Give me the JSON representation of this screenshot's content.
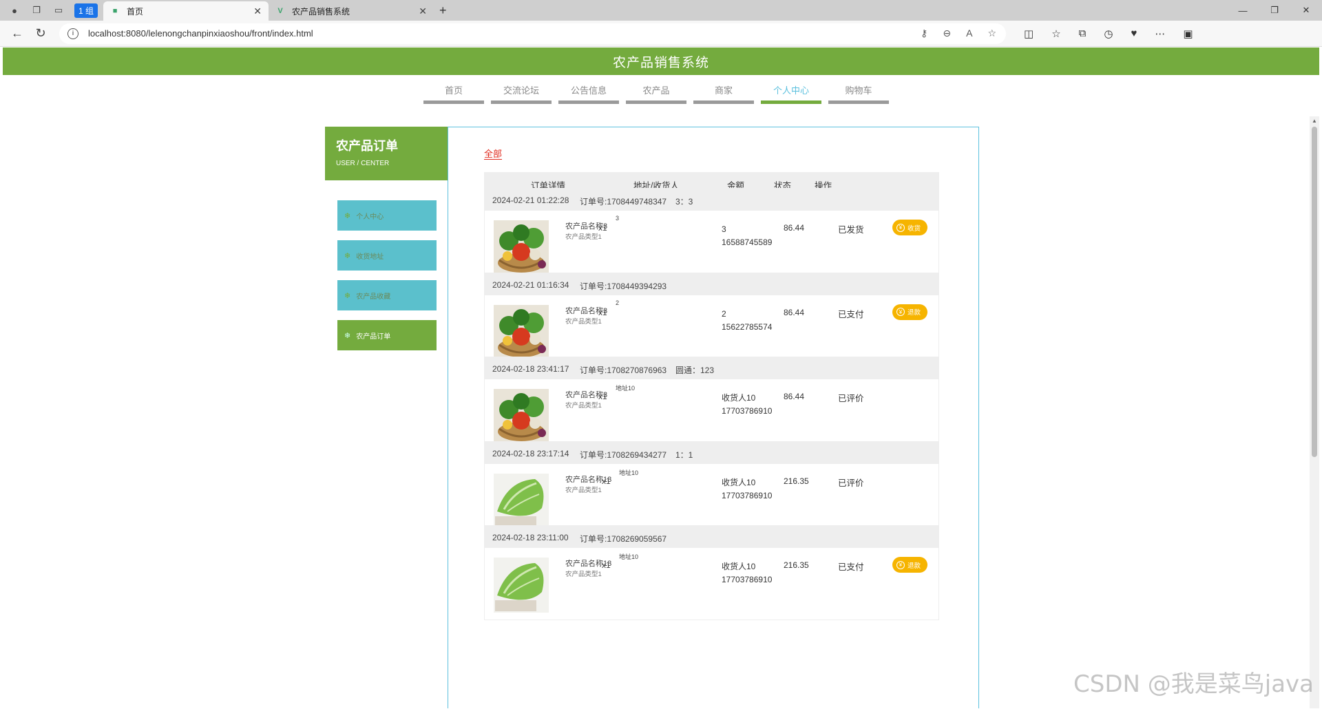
{
  "browser": {
    "group_label": "1 组",
    "tabs": [
      {
        "title": "首页",
        "active": true
      },
      {
        "title": "农产品销售系统",
        "active": false
      }
    ],
    "url": "localhost:8080/lelenongchanpinxiaoshou/front/index.html"
  },
  "site": {
    "title": "农产品销售系统",
    "nav": [
      "首页",
      "交流论坛",
      "公告信息",
      "农产品",
      "商家",
      "个人中心",
      "购物车"
    ],
    "active_nav": "个人中心"
  },
  "sidebar": {
    "title": "农产品订单",
    "subtitle": "USER / CENTER",
    "items": [
      "个人中心",
      "收货地址",
      "农产品收藏",
      "农产品订单"
    ],
    "active_item": "农产品订单"
  },
  "orders_panel": {
    "filter_label": "全部",
    "headers": [
      "订单详情",
      "地址/收货人",
      "金额",
      "状态",
      "操作"
    ],
    "orders": [
      {
        "time": "2024-02-21 01:22:28",
        "order_no": "订单号:1708449748347",
        "extra": "3：3",
        "product": "农产品名称3",
        "type": "农产品类型1",
        "qty": "x1",
        "addr": "3",
        "receiver": "3",
        "phone": "16588745589",
        "amount": "86.44",
        "status": "已发货",
        "action": "收货",
        "image": "veggie-basket"
      },
      {
        "time": "2024-02-21 01:16:34",
        "order_no": "订单号:1708449394293",
        "extra": "",
        "product": "农产品名称3",
        "type": "农产品类型1",
        "qty": "x1",
        "addr": "2",
        "receiver": "2",
        "phone": "15622785574",
        "amount": "86.44",
        "status": "已支付",
        "action": "退款",
        "image": "veggie-basket"
      },
      {
        "time": "2024-02-18 23:41:17",
        "order_no": "订单号:1708270876963",
        "extra": "圆通：123",
        "product": "农产品名称3",
        "type": "农产品类型1",
        "qty": "x1",
        "addr": "地址10",
        "receiver": "收货人10",
        "phone": "17703786910",
        "amount": "86.44",
        "status": "已评价",
        "action": "",
        "image": "veggie-basket"
      },
      {
        "time": "2024-02-18 23:17:14",
        "order_no": "订单号:1708269434277",
        "extra": "1：1",
        "product": "农产品名称13",
        "type": "农产品类型1",
        "qty": "x1",
        "addr": "地址10",
        "receiver": "收货人10",
        "phone": "17703786910",
        "amount": "216.35",
        "status": "已评价",
        "action": "",
        "image": "cabbage"
      },
      {
        "time": "2024-02-18 23:11:00",
        "order_no": "订单号:1708269059567",
        "extra": "",
        "product": "农产品名称13",
        "type": "农产品类型1",
        "qty": "x1",
        "addr": "地址10",
        "receiver": "收货人10",
        "phone": "17703786910",
        "amount": "216.35",
        "status": "已支付",
        "action": "退款",
        "image": "cabbage"
      }
    ]
  },
  "watermark": "CSDN @我是菜鸟java"
}
